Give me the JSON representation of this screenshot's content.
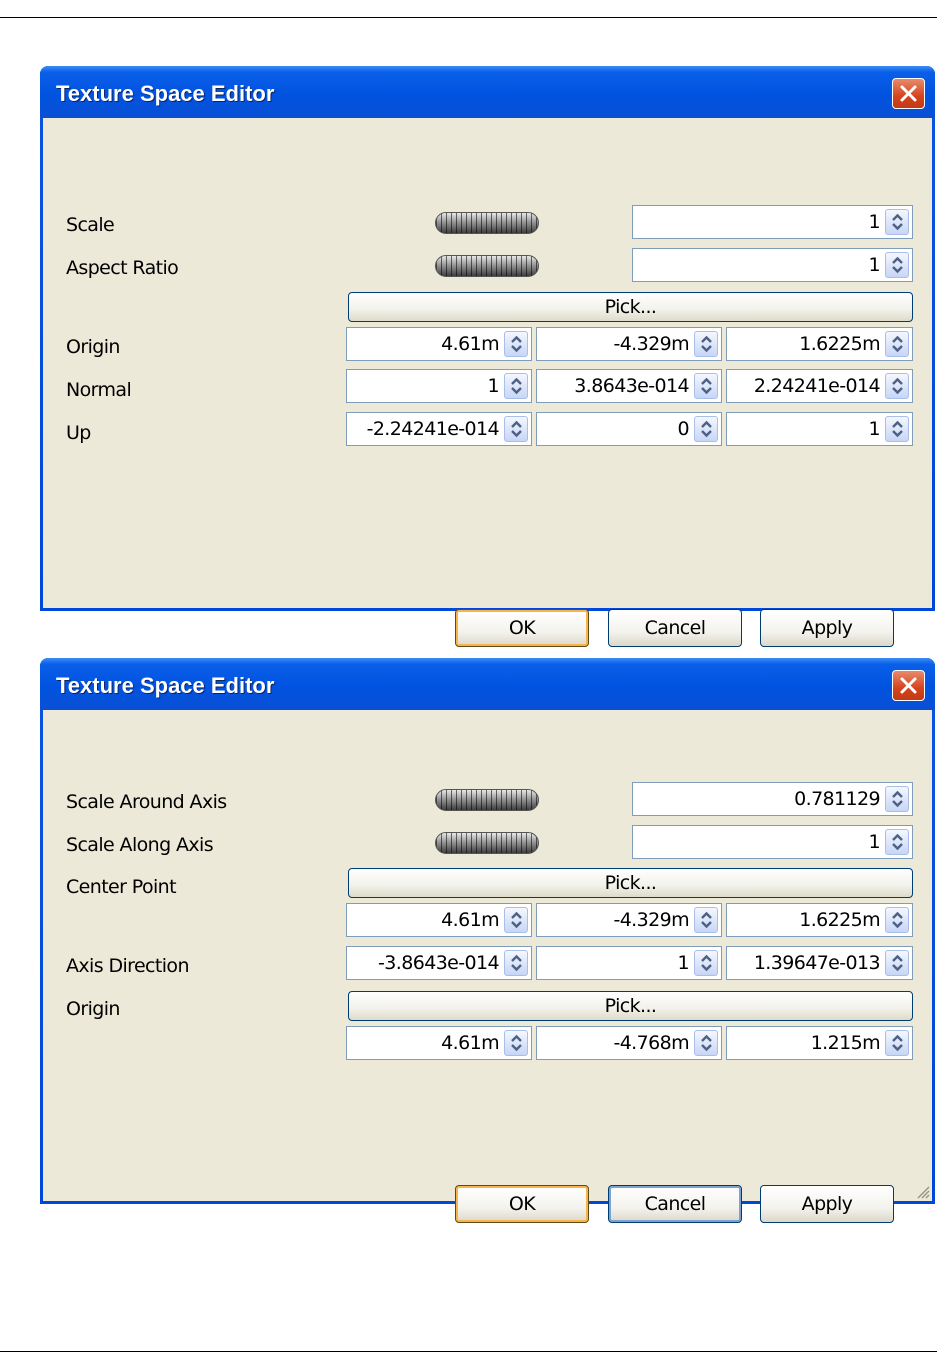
{
  "dialog1": {
    "title": "Texture Space Editor",
    "labels": {
      "scale": "Scale",
      "aspect_ratio": "Aspect Ratio",
      "origin": "Origin",
      "normal": "Normal",
      "up": "Up"
    },
    "scale_value": "1",
    "aspect_ratio_value": "1",
    "pick_label": "Pick...",
    "origin": [
      "4.61m",
      "-4.329m",
      "1.6225m"
    ],
    "normal": [
      "1",
      "3.8643e-014",
      "2.24241e-014"
    ],
    "up": [
      "-2.24241e-014",
      "0",
      "1"
    ],
    "buttons": {
      "ok": "OK",
      "cancel": "Cancel",
      "apply": "Apply"
    }
  },
  "dialog2": {
    "title": "Texture Space Editor",
    "labels": {
      "scale_around_axis": "Scale Around Axis",
      "scale_along_axis": "Scale Along Axis",
      "center_point": "Center Point",
      "axis_direction": "Axis Direction",
      "origin": "Origin"
    },
    "scale_around_axis_value": "0.781129",
    "scale_along_axis_value": "1",
    "center_pick_label": "Pick...",
    "center_point": [
      "4.61m",
      "-4.329m",
      "1.6225m"
    ],
    "axis_direction": [
      "-3.8643e-014",
      "1",
      "1.39647e-013"
    ],
    "origin_pick_label": "Pick...",
    "origin": [
      "4.61m",
      "-4.768m",
      "1.215m"
    ],
    "buttons": {
      "ok": "OK",
      "cancel": "Cancel",
      "apply": "Apply"
    }
  },
  "colors": {
    "titlebar": "#0053e0",
    "client": "#ece9d8",
    "close": "#d5431d",
    "default_button_ring": "#f8b34a"
  }
}
